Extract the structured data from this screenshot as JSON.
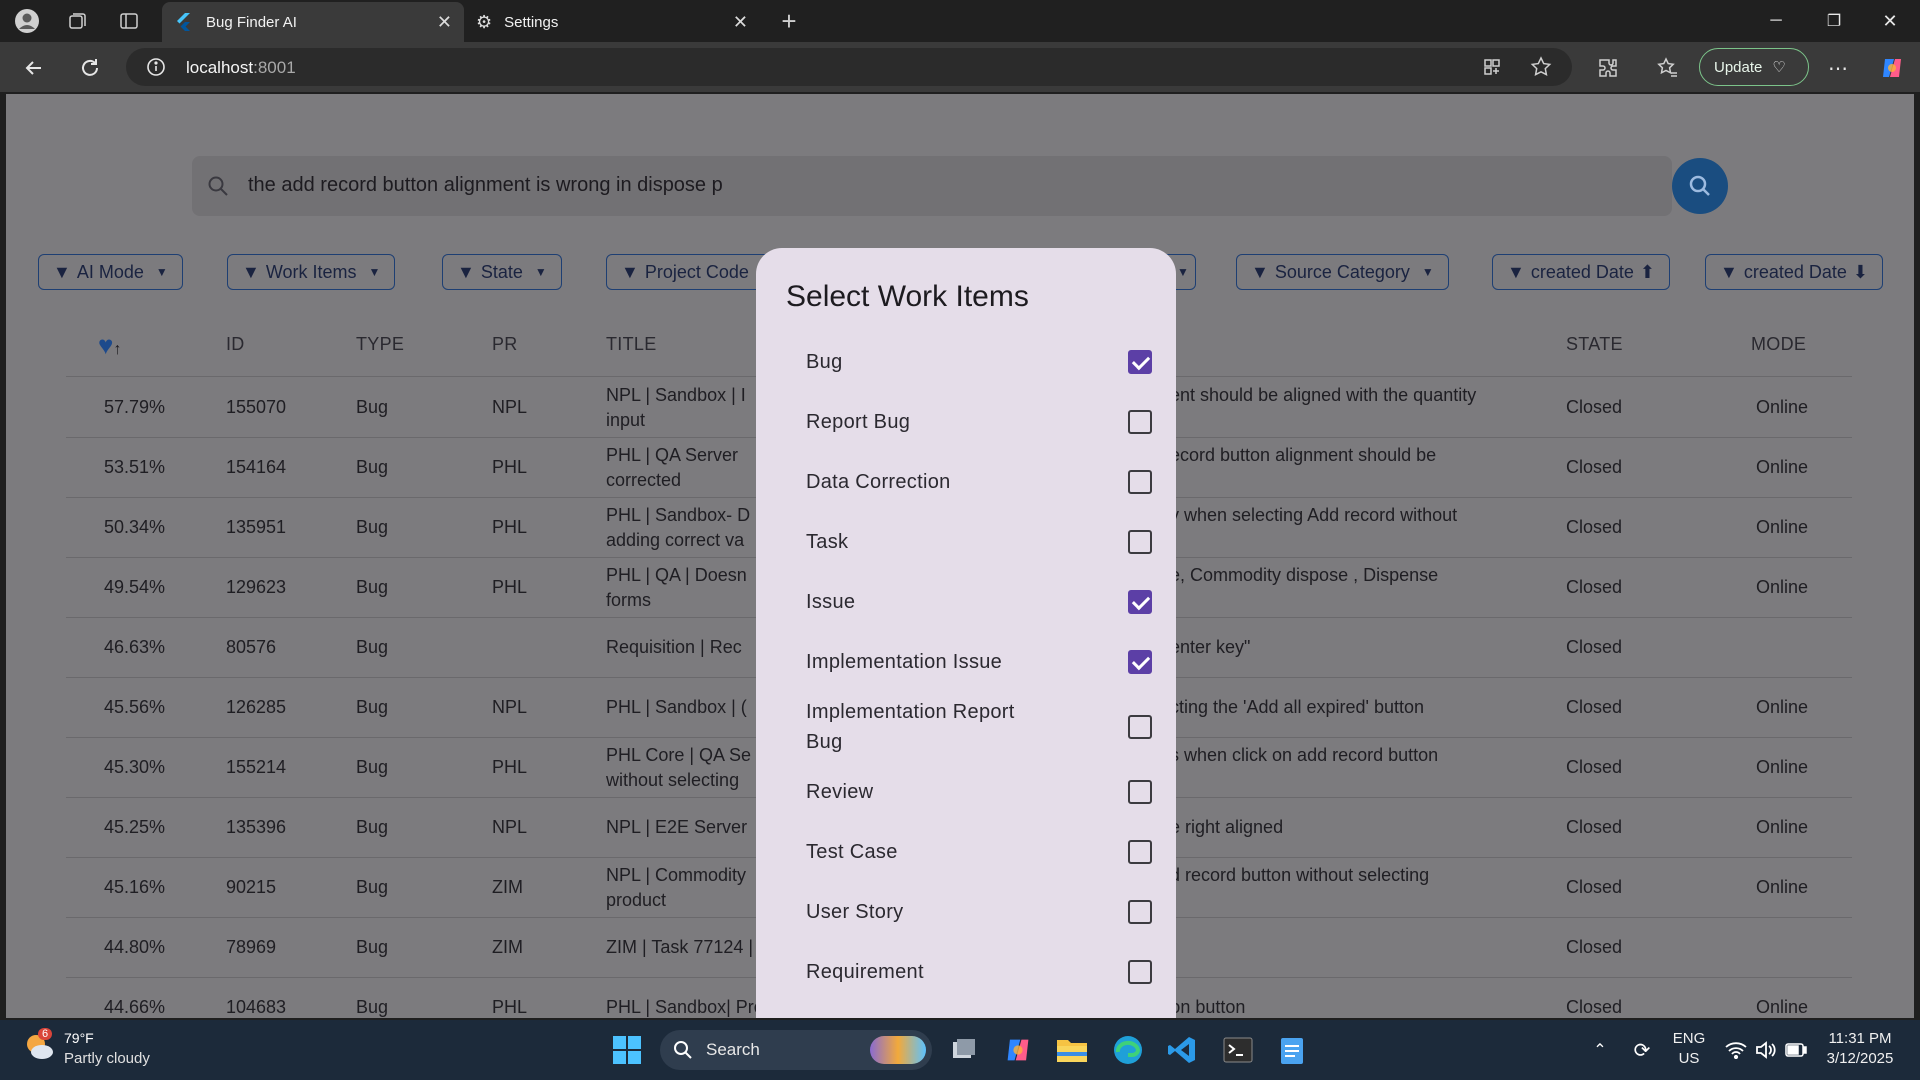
{
  "browser": {
    "tabs": [
      {
        "label": "Bug Finder AI",
        "active": true
      },
      {
        "label": "Settings",
        "active": false
      }
    ],
    "url_host": "localhost",
    "url_port": ":8001",
    "update_label": "Update"
  },
  "search": {
    "value": "the add record button alignment is wrong in dispose p"
  },
  "filters": [
    {
      "label": "AI Mode"
    },
    {
      "label": "Work Items"
    },
    {
      "label": "State"
    },
    {
      "label": "Project Code"
    },
    {
      "label": "Source Category"
    },
    {
      "label": "created Date",
      "arrow": "up"
    },
    {
      "label": "created Date",
      "arrow": "down"
    }
  ],
  "table": {
    "headers": {
      "id": "ID",
      "type": "TYPE",
      "pr": "PR",
      "title": "TITLE",
      "state": "STATE",
      "mode": "MODE"
    },
    "rows": [
      {
        "score": "57.79%",
        "id": "155070",
        "type": "Bug",
        "pr": "NPL",
        "title_left": "NPL | Sandbox | I",
        "title_right": "ent should be aligned with the quantity",
        "title_line2": "input",
        "state": "Closed",
        "mode": "Online"
      },
      {
        "score": "53.51%",
        "id": "154164",
        "type": "Bug",
        "pr": "PHL",
        "title_left": "PHL | QA Server",
        "title_right": "ecord button alignment should be",
        "title_line2": "corrected",
        "state": "Closed",
        "mode": "Online"
      },
      {
        "score": "50.34%",
        "id": "135951",
        "type": "Bug",
        "pr": "PHL",
        "title_left": "PHL | Sandbox- D",
        "title_right": "y when selecting Add record  without",
        "title_line2": "adding correct va",
        "state": "Closed",
        "mode": "Online"
      },
      {
        "score": "49.54%",
        "id": "129623",
        "type": "Bug",
        "pr": "PHL",
        "title_left": "PHL | QA | Doesn",
        "title_right": "e, Commodity dispose , Dispense",
        "title_line2": "forms",
        "state": "Closed",
        "mode": "Online"
      },
      {
        "score": "46.63%",
        "id": "80576",
        "type": "Bug",
        "pr": "",
        "title_left": "Requisition | Rec",
        "title_right": "enter key\"",
        "title_line2": "",
        "state": "Closed",
        "mode": ""
      },
      {
        "score": "45.56%",
        "id": "126285",
        "type": "Bug",
        "pr": "NPL",
        "title_left": "PHL | Sandbox | (",
        "title_right": "cting the 'Add all expired' button",
        "title_line2": "",
        "state": "Closed",
        "mode": "Online"
      },
      {
        "score": "45.30%",
        "id": "155214",
        "type": "Bug",
        "pr": "PHL",
        "title_left": "PHL Core | QA Se",
        "title_right": "s when click on add record button",
        "title_line2": "without selecting",
        "state": "Closed",
        "mode": "Online"
      },
      {
        "score": "45.25%",
        "id": "135396",
        "type": "Bug",
        "pr": "NPL",
        "title_left": "NPL | E2E Server",
        "title_right": "e right aligned",
        "title_line2": "",
        "state": "Closed",
        "mode": "Online"
      },
      {
        "score": "45.16%",
        "id": "90215",
        "type": "Bug",
        "pr": "ZIM",
        "title_left": "NPL | Commodity",
        "title_right": "d record button without selecting",
        "title_line2": "product",
        "state": "Closed",
        "mode": "Online"
      },
      {
        "score": "44.80%",
        "id": "78969",
        "type": "Bug",
        "pr": "ZIM",
        "title_left": "ZIM | Task 77124 |",
        "title_right": "",
        "title_line2": "",
        "state": "Closed",
        "mode": ""
      },
      {
        "score": "44.66%",
        "id": "104683",
        "type": "Bug",
        "pr": "PHL",
        "title_left": "PHL | Sandbox| Procurement| Purchase Order | Alignment Issue in Action button",
        "title_right": "",
        "title_line2": "",
        "state": "Closed",
        "mode": "Online"
      }
    ]
  },
  "modal": {
    "title": "Select Work Items",
    "options": [
      {
        "label": "Bug",
        "checked": true
      },
      {
        "label": "Report Bug",
        "checked": false
      },
      {
        "label": "Data Correction",
        "checked": false
      },
      {
        "label": "Task",
        "checked": false
      },
      {
        "label": "Issue",
        "checked": true
      },
      {
        "label": "Implementation Issue",
        "checked": true
      },
      {
        "label": "Implementation Report Bug",
        "checked": false
      },
      {
        "label": "Review",
        "checked": false
      },
      {
        "label": "Test Case",
        "checked": false
      },
      {
        "label": "User Story",
        "checked": false
      },
      {
        "label": "Requirement",
        "checked": false
      }
    ]
  },
  "taskbar": {
    "weather_badge": "6",
    "weather_temp": "79°F",
    "weather_desc": "Partly cloudy",
    "search_label": "Search",
    "lang1": "ENG",
    "lang2": "US",
    "time": "11:31 PM",
    "date": "3/12/2025"
  },
  "colors": {
    "accent": "#5c3fa6",
    "search_button": "#1a4d80",
    "filter_border": "#1e3f73",
    "modal_bg": "#e5dde9"
  }
}
